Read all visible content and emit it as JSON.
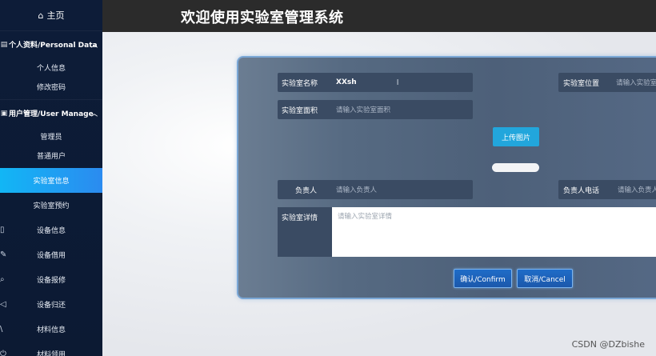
{
  "header": {
    "title": "欢迎使用实验室管理系统"
  },
  "sidebar": {
    "home": {
      "icon": "home-icon",
      "label": "主页"
    },
    "groups": [
      {
        "icon": "document-icon",
        "label": "个人资料/Personal Data",
        "items": [
          "个人信息",
          "修改密码"
        ]
      },
      {
        "icon": "user-manage-icon",
        "label": "用户管理/User Manage",
        "items": [
          "管理员",
          "普通用户"
        ]
      }
    ],
    "items": [
      {
        "label": "实验室信息",
        "active": true
      },
      {
        "label": "实验室预约"
      },
      {
        "label": "设备信息",
        "icon": "device-icon"
      },
      {
        "label": "设备借用",
        "icon": "pen-icon"
      },
      {
        "label": "设备报修",
        "icon": "repair-icon"
      },
      {
        "label": "设备归还",
        "icon": "return-icon"
      },
      {
        "label": "材料信息",
        "icon": "slash-icon"
      },
      {
        "label": "材料领用",
        "icon": "power-icon"
      }
    ]
  },
  "form": {
    "name": {
      "label": "实验室名称",
      "value": "XXsh"
    },
    "location": {
      "label": "实验室位置",
      "placeholder": "请输入实验室位"
    },
    "area": {
      "label": "实验室面积",
      "placeholder": "请输入实验室面积"
    },
    "upload_label": "上传图片",
    "owner": {
      "label": "负责人",
      "placeholder": "请输入负责人"
    },
    "phone": {
      "label": "负责人电话",
      "placeholder": "请输入负责人"
    },
    "detail": {
      "label": "实验室详情",
      "placeholder": "请输入实验室详情"
    },
    "confirm_label": "确认/Confirm",
    "cancel_label": "取消/Cancel"
  },
  "watermark": "CSDN @DZbishe",
  "colors": {
    "sidebar_bg": "#0d1c38",
    "active_item": "#12b6f5",
    "header_bg": "#2b2b2b",
    "upload_button": "#22a6dc",
    "confirm_button": "#1f6cc8"
  }
}
